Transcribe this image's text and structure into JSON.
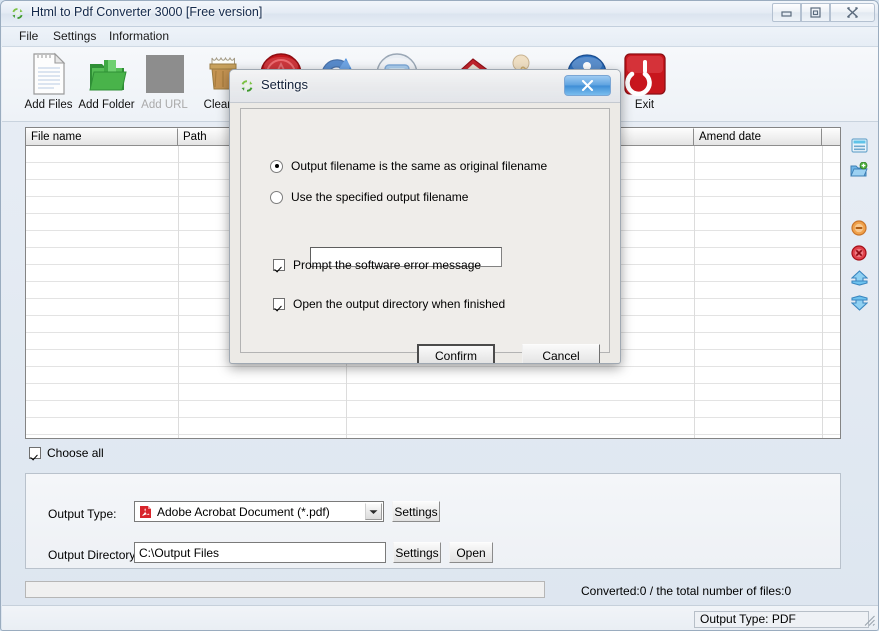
{
  "window": {
    "title": "Html to Pdf Converter 3000 [Free version]",
    "icon": "refresh-green-icon",
    "buttons": {
      "minimize": "minimize-button",
      "maximize": "maximize-button",
      "close": "close-button"
    }
  },
  "menubar": {
    "items": [
      {
        "label": "File",
        "name": "menu-file"
      },
      {
        "label": "Settings",
        "name": "menu-settings"
      },
      {
        "label": "Information",
        "name": "menu-information"
      }
    ]
  },
  "toolbar": {
    "buttons": [
      {
        "label": "Add Files",
        "icon": "document-page-icon",
        "disabled": false
      },
      {
        "label": "Add Folder",
        "icon": "green-folder-icon",
        "disabled": false
      },
      {
        "label": "Add URL",
        "icon": "globe-url-icon",
        "disabled": true
      },
      {
        "label": "Clear F",
        "icon": "trash-bin-icon",
        "disabled": false
      },
      {
        "label": "",
        "icon": "stop-sign-icon",
        "disabled": false
      },
      {
        "label": "",
        "icon": "blue-convert-icon",
        "disabled": false
      },
      {
        "label": "",
        "icon": "monitor-icon",
        "disabled": false
      },
      {
        "label": "",
        "icon": "red-book-icon",
        "disabled": false
      },
      {
        "label": "",
        "icon": "pencil-icon",
        "disabled": false
      },
      {
        "label": "",
        "icon": "blue-info-icon",
        "disabled": false
      },
      {
        "label": "Exit",
        "icon": "red-power-icon",
        "disabled": false
      }
    ]
  },
  "filelist": {
    "columns": [
      {
        "label": "File name"
      },
      {
        "label": "Path"
      },
      {
        "label": ""
      },
      {
        "label": "Amend date"
      },
      {
        "label": ""
      }
    ],
    "rows": []
  },
  "sidestrip": {
    "icons": [
      {
        "name": "window-list-icon"
      },
      {
        "name": "add-folder-icon"
      },
      {
        "name": "remove-item-icon"
      },
      {
        "name": "delete-all-icon"
      },
      {
        "name": "move-up-icon"
      },
      {
        "name": "move-down-icon"
      }
    ]
  },
  "choose_all": {
    "label": "Choose all",
    "checked": true
  },
  "output": {
    "type_label": "Output Type:",
    "type_value": "Adobe Acrobat Document (*.pdf)",
    "type_icon": "adobe-acrobat-icon",
    "type_settings_label": "Settings",
    "directory_label": "Output Directory:",
    "directory_value": "C:\\Output Files",
    "directory_settings_label": "Settings",
    "directory_open_label": "Open"
  },
  "status": {
    "converted_text": "Converted:0  /  the total number of files:0",
    "output_type_text": "Output Type: PDF",
    "progress_percent": 0
  },
  "dialog": {
    "title": "Settings",
    "icon": "refresh-green-icon",
    "close_label": "x",
    "radio_same_name": "Output filename is the same as original filename",
    "radio_same_selected": true,
    "radio_specified": "Use the specified output filename",
    "radio_specified_selected": false,
    "filename_input_value": "",
    "check_prompt_error": "Prompt the software error message",
    "check_prompt_error_checked": true,
    "check_open_dir": "Open the output directory when finished",
    "check_open_dir_checked": true,
    "confirm_label": "Confirm",
    "cancel_label": "Cancel"
  },
  "colors": {
    "accent": "#3f8ed6",
    "titlebar": "#e4ebf4",
    "exit_red": "#c8161d",
    "folder_green": "#49a546"
  }
}
